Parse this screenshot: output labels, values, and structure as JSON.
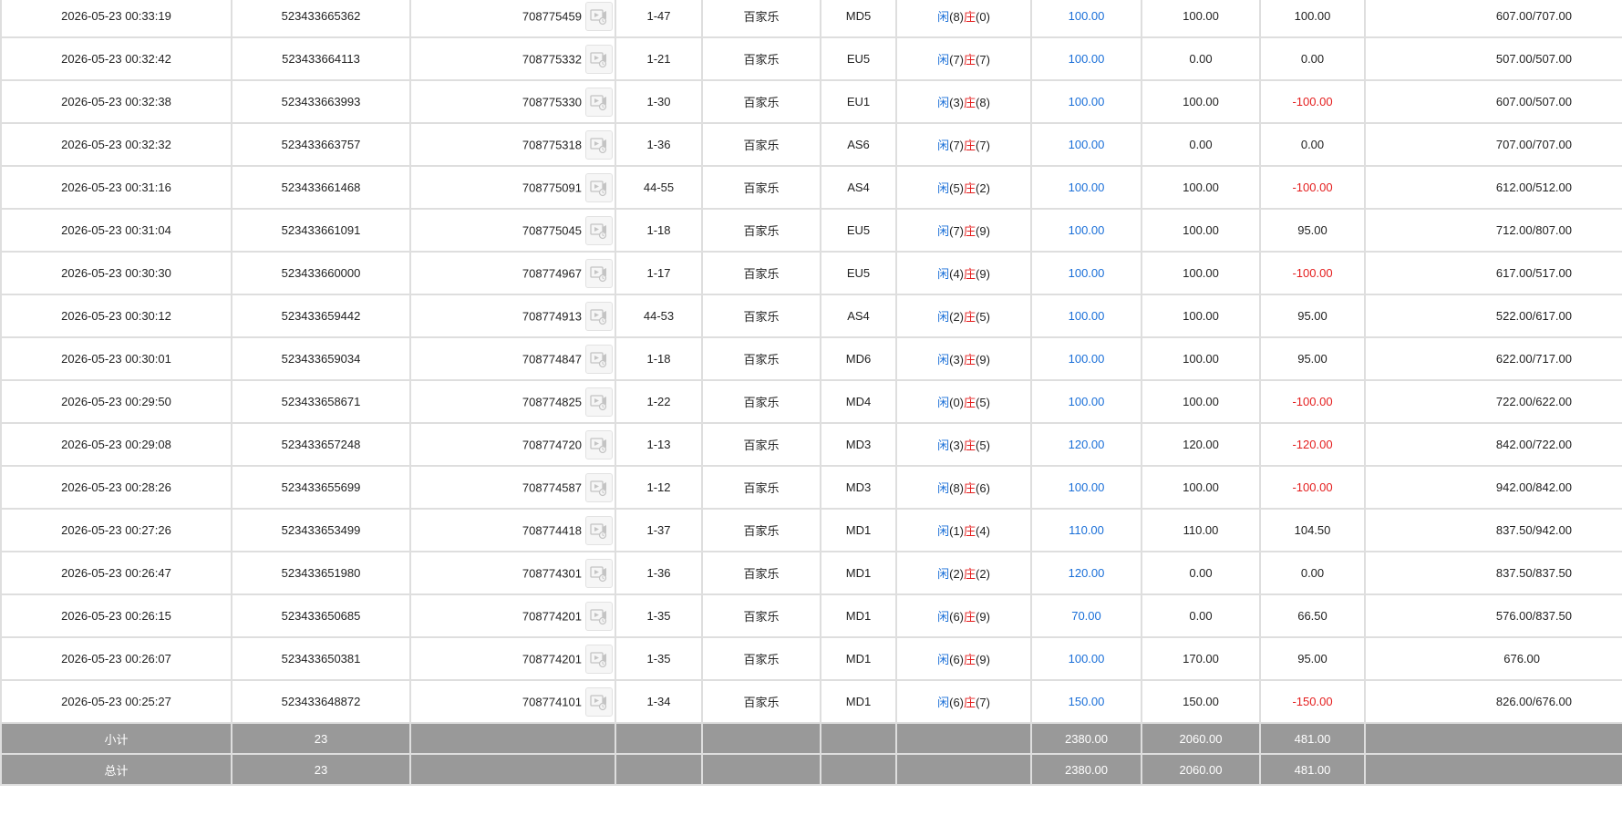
{
  "colors": {
    "amount_blue": "#1a6fd8",
    "loss_red": "#e41d1d",
    "summary_bg": "#999999",
    "grid_border": "#dedede"
  },
  "icons": {
    "replay": "replay-video-icon"
  },
  "rows": [
    {
      "time": "2026-05-23 00:33:19",
      "order": "523433665362",
      "round": "708775459",
      "shoe": "1-47",
      "game": "百家乐",
      "table": "MD5",
      "player_label": "闲",
      "player_pts": "(8)",
      "banker_label": "庄",
      "banker_pts": "(0)",
      "bet": "100.00",
      "valid": "100.00",
      "payout": "100.00",
      "payout_neg": false,
      "balance": "607.00/707.00"
    },
    {
      "time": "2026-05-23 00:32:42",
      "order": "523433664113",
      "round": "708775332",
      "shoe": "1-21",
      "game": "百家乐",
      "table": "EU5",
      "player_label": "闲",
      "player_pts": "(7)",
      "banker_label": "庄",
      "banker_pts": "(7)",
      "bet": "100.00",
      "valid": "0.00",
      "payout": "0.00",
      "payout_neg": false,
      "balance": "507.00/507.00"
    },
    {
      "time": "2026-05-23 00:32:38",
      "order": "523433663993",
      "round": "708775330",
      "shoe": "1-30",
      "game": "百家乐",
      "table": "EU1",
      "player_label": "闲",
      "player_pts": "(3)",
      "banker_label": "庄",
      "banker_pts": "(8)",
      "bet": "100.00",
      "valid": "100.00",
      "payout": "-100.00",
      "payout_neg": true,
      "balance": "607.00/507.00"
    },
    {
      "time": "2026-05-23 00:32:32",
      "order": "523433663757",
      "round": "708775318",
      "shoe": "1-36",
      "game": "百家乐",
      "table": "AS6",
      "player_label": "闲",
      "player_pts": "(7)",
      "banker_label": "庄",
      "banker_pts": "(7)",
      "bet": "100.00",
      "valid": "0.00",
      "payout": "0.00",
      "payout_neg": false,
      "balance": "707.00/707.00"
    },
    {
      "time": "2026-05-23 00:31:16",
      "order": "523433661468",
      "round": "708775091",
      "shoe": "44-55",
      "game": "百家乐",
      "table": "AS4",
      "player_label": "闲",
      "player_pts": "(5)",
      "banker_label": "庄",
      "banker_pts": "(2)",
      "bet": "100.00",
      "valid": "100.00",
      "payout": "-100.00",
      "payout_neg": true,
      "balance": "612.00/512.00"
    },
    {
      "time": "2026-05-23 00:31:04",
      "order": "523433661091",
      "round": "708775045",
      "shoe": "1-18",
      "game": "百家乐",
      "table": "EU5",
      "player_label": "闲",
      "player_pts": "(7)",
      "banker_label": "庄",
      "banker_pts": "(9)",
      "bet": "100.00",
      "valid": "100.00",
      "payout": "95.00",
      "payout_neg": false,
      "balance": "712.00/807.00"
    },
    {
      "time": "2026-05-23 00:30:30",
      "order": "523433660000",
      "round": "708774967",
      "shoe": "1-17",
      "game": "百家乐",
      "table": "EU5",
      "player_label": "闲",
      "player_pts": "(4)",
      "banker_label": "庄",
      "banker_pts": "(9)",
      "bet": "100.00",
      "valid": "100.00",
      "payout": "-100.00",
      "payout_neg": true,
      "balance": "617.00/517.00"
    },
    {
      "time": "2026-05-23 00:30:12",
      "order": "523433659442",
      "round": "708774913",
      "shoe": "44-53",
      "game": "百家乐",
      "table": "AS4",
      "player_label": "闲",
      "player_pts": "(2)",
      "banker_label": "庄",
      "banker_pts": "(5)",
      "bet": "100.00",
      "valid": "100.00",
      "payout": "95.00",
      "payout_neg": false,
      "balance": "522.00/617.00"
    },
    {
      "time": "2026-05-23 00:30:01",
      "order": "523433659034",
      "round": "708774847",
      "shoe": "1-18",
      "game": "百家乐",
      "table": "MD6",
      "player_label": "闲",
      "player_pts": "(3)",
      "banker_label": "庄",
      "banker_pts": "(9)",
      "bet": "100.00",
      "valid": "100.00",
      "payout": "95.00",
      "payout_neg": false,
      "balance": "622.00/717.00"
    },
    {
      "time": "2026-05-23 00:29:50",
      "order": "523433658671",
      "round": "708774825",
      "shoe": "1-22",
      "game": "百家乐",
      "table": "MD4",
      "player_label": "闲",
      "player_pts": "(0)",
      "banker_label": "庄",
      "banker_pts": "(5)",
      "bet": "100.00",
      "valid": "100.00",
      "payout": "-100.00",
      "payout_neg": true,
      "balance": "722.00/622.00"
    },
    {
      "time": "2026-05-23 00:29:08",
      "order": "523433657248",
      "round": "708774720",
      "shoe": "1-13",
      "game": "百家乐",
      "table": "MD3",
      "player_label": "闲",
      "player_pts": "(3)",
      "banker_label": "庄",
      "banker_pts": "(5)",
      "bet": "120.00",
      "valid": "120.00",
      "payout": "-120.00",
      "payout_neg": true,
      "balance": "842.00/722.00"
    },
    {
      "time": "2026-05-23 00:28:26",
      "order": "523433655699",
      "round": "708774587",
      "shoe": "1-12",
      "game": "百家乐",
      "table": "MD3",
      "player_label": "闲",
      "player_pts": "(8)",
      "banker_label": "庄",
      "banker_pts": "(6)",
      "bet": "100.00",
      "valid": "100.00",
      "payout": "-100.00",
      "payout_neg": true,
      "balance": "942.00/842.00"
    },
    {
      "time": "2026-05-23 00:27:26",
      "order": "523433653499",
      "round": "708774418",
      "shoe": "1-37",
      "game": "百家乐",
      "table": "MD1",
      "player_label": "闲",
      "player_pts": "(1)",
      "banker_label": "庄",
      "banker_pts": "(4)",
      "bet": "110.00",
      "valid": "110.00",
      "payout": "104.50",
      "payout_neg": false,
      "balance": "837.50/942.00"
    },
    {
      "time": "2026-05-23 00:26:47",
      "order": "523433651980",
      "round": "708774301",
      "shoe": "1-36",
      "game": "百家乐",
      "table": "MD1",
      "player_label": "闲",
      "player_pts": "(2)",
      "banker_label": "庄",
      "banker_pts": "(2)",
      "bet": "120.00",
      "valid": "0.00",
      "payout": "0.00",
      "payout_neg": false,
      "balance": "837.50/837.50"
    },
    {
      "time": "2026-05-23 00:26:15",
      "order": "523433650685",
      "round": "708774201",
      "shoe": "1-35",
      "game": "百家乐",
      "table": "MD1",
      "player_label": "闲",
      "player_pts": "(6)",
      "banker_label": "庄",
      "banker_pts": "(9)",
      "bet": "70.00",
      "valid": "0.00",
      "payout": "66.50",
      "payout_neg": false,
      "balance": "576.00/837.50"
    },
    {
      "time": "2026-05-23 00:26:07",
      "order": "523433650381",
      "round": "708774201",
      "shoe": "1-35",
      "game": "百家乐",
      "table": "MD1",
      "player_label": "闲",
      "player_pts": "(6)",
      "banker_label": "庄",
      "banker_pts": "(9)",
      "bet": "100.00",
      "valid": "170.00",
      "payout": "95.00",
      "payout_neg": false,
      "balance": "676.00"
    },
    {
      "time": "2026-05-23 00:25:27",
      "order": "523433648872",
      "round": "708774101",
      "shoe": "1-34",
      "game": "百家乐",
      "table": "MD1",
      "player_label": "闲",
      "player_pts": "(6)",
      "banker_label": "庄",
      "banker_pts": "(7)",
      "bet": "150.00",
      "valid": "150.00",
      "payout": "-150.00",
      "payout_neg": true,
      "balance": "826.00/676.00"
    }
  ],
  "subtotal": {
    "label": "小计",
    "count": "23",
    "bet": "2380.00",
    "valid": "2060.00",
    "payout": "481.00"
  },
  "total": {
    "label": "总计",
    "count": "23",
    "bet": "2380.00",
    "valid": "2060.00",
    "payout": "481.00"
  }
}
